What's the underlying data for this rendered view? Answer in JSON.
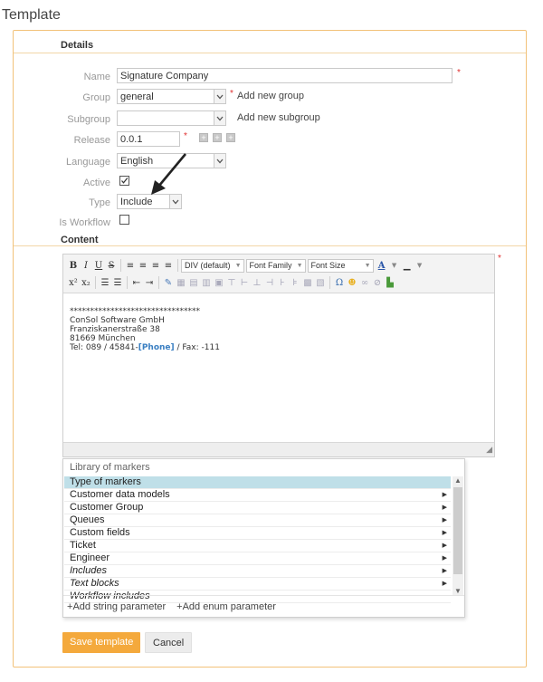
{
  "page_title": "Template",
  "details": {
    "heading": "Details",
    "fields": {
      "name": {
        "label": "Name",
        "value": "Signature Company"
      },
      "group": {
        "label": "Group",
        "value": "general",
        "add_link": "Add new group"
      },
      "subgroup": {
        "label": "Subgroup",
        "value": "",
        "add_link": "Add new subgroup"
      },
      "release": {
        "label": "Release",
        "value": "0.0.1"
      },
      "language": {
        "label": "Language",
        "value": "English"
      },
      "active": {
        "label": "Active",
        "checked": true
      },
      "type": {
        "label": "Type",
        "value": "Include"
      },
      "is_workflow": {
        "label": "Is Workflow",
        "checked": false
      }
    },
    "required_mark": "*"
  },
  "content": {
    "heading": "Content",
    "toolbar": {
      "format_select": "DIV (default)",
      "font_family_select": "Font Family",
      "font_size_select": "Font Size"
    },
    "editor_lines": [
      "********************************",
      "ConSol Software GmbH",
      "Franziskanerstraße 38",
      "81669 München"
    ],
    "editor_tel_prefix": "Tel: 089 / 45841-",
    "editor_marker": "[Phone]",
    "editor_tel_suffix": " / Fax: -111"
  },
  "library": {
    "title": "Library of markers",
    "items": [
      {
        "label": "Type of markers",
        "selected": true,
        "italic": false,
        "has_submenu": false
      },
      {
        "label": "Customer data models",
        "selected": false,
        "italic": false,
        "has_submenu": true
      },
      {
        "label": "Customer Group",
        "selected": false,
        "italic": false,
        "has_submenu": true
      },
      {
        "label": "Queues",
        "selected": false,
        "italic": false,
        "has_submenu": true
      },
      {
        "label": "Custom fields",
        "selected": false,
        "italic": false,
        "has_submenu": true
      },
      {
        "label": "Ticket",
        "selected": false,
        "italic": false,
        "has_submenu": true
      },
      {
        "label": "Engineer",
        "selected": false,
        "italic": false,
        "has_submenu": true
      },
      {
        "label": "Includes",
        "selected": false,
        "italic": true,
        "has_submenu": true
      },
      {
        "label": "Text blocks",
        "selected": false,
        "italic": true,
        "has_submenu": true
      },
      {
        "label": "Workflow includes",
        "selected": false,
        "italic": true,
        "has_submenu": false
      }
    ],
    "add_string": "Add string parameter",
    "add_enum": "Add enum parameter"
  },
  "actions": {
    "save": "Save template",
    "cancel": "Cancel"
  },
  "colors": {
    "accent": "#f4a93c",
    "panel_border": "#f2c27a",
    "selected_row": "#bfdfe8",
    "marker": "#3a7fc2",
    "required": "#e03030"
  }
}
